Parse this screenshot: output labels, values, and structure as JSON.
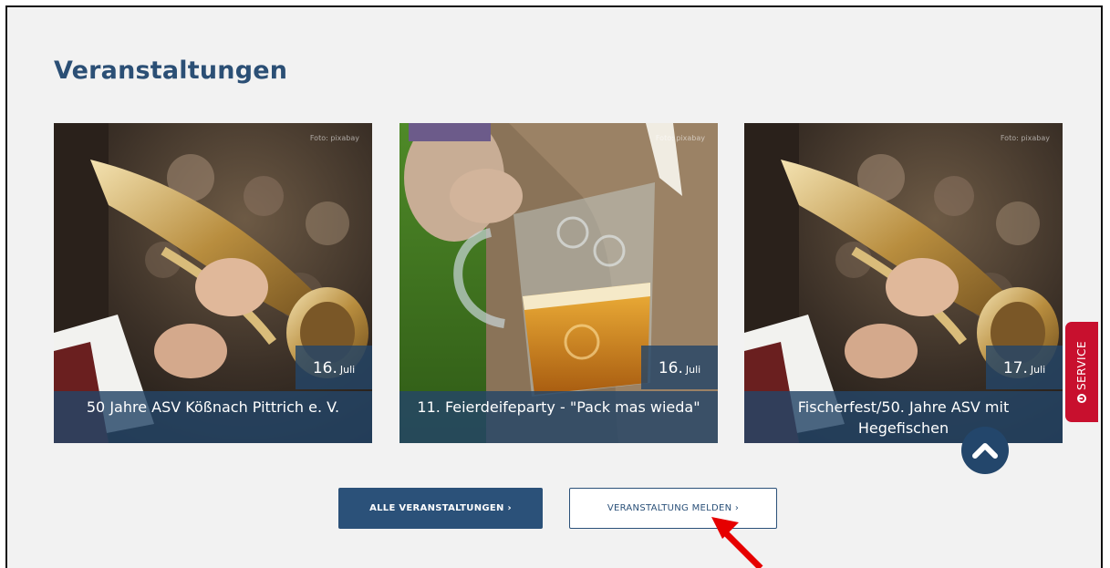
{
  "section": {
    "title": "Veranstaltungen"
  },
  "events": [
    {
      "credit": "Foto: pixabay",
      "day": "16.",
      "month": "Juli",
      "title": "50 Jahre ASV Kößnach Pittrich e. V.",
      "image": "trumpet-player-photo"
    },
    {
      "credit": "Foto: pixabay",
      "day": "16.",
      "month": "Juli",
      "title": "11. Feierdeifeparty - \"Pack mas wieda\"",
      "image": "beer-mug-photo"
    },
    {
      "credit": "Foto: pixabay",
      "day": "17.",
      "month": "Juli",
      "title": "Fischerfest/50. Jahre ASV mit Hegefischen",
      "image": "trumpet-player-photo"
    }
  ],
  "buttons": {
    "all_events": "ALLE VERANSTALTUNGEN ›",
    "report_event": "VERANSTALTUNG MELDEN ›"
  },
  "service_tab": {
    "label": "SERVICE",
    "icon": "info-circle-icon"
  },
  "scroll_top": {
    "icon": "chevron-up-icon"
  },
  "annotation": {
    "icon": "red-arrow-icon",
    "color": "#e60000"
  },
  "colors": {
    "brand": "#2b5179",
    "overlay": "#254668",
    "service": "#c8102e",
    "title": "#2b4f75"
  }
}
